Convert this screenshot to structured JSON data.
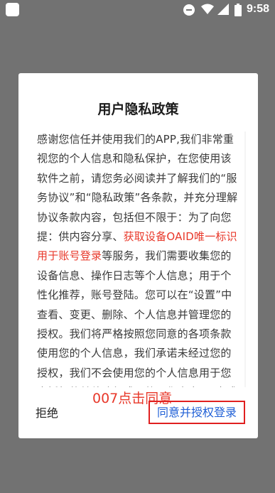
{
  "status_bar": {
    "time": "9:58",
    "icons": [
      "app-icon",
      "do-not-disturb-icon",
      "wifi-icon",
      "signal-icon",
      "battery-icon"
    ]
  },
  "dialog": {
    "title": "用户隐私政策",
    "body_before_link": "感谢您信任并使用我们的APP,我们非常重视您的个人信息和隐私保护，在您使用该软件之前，请您务必阅读并了解我们的“服务协议”和“隐私政策”各条款，并充分理解协议条款内容，包括但不限于：为了向您提：供内容分享、",
    "body_link": "获取设备OAID唯一标识用于账号登录",
    "body_after_link": "等服务，我们需要收集您的设备信息、操作日志等个人信息；用于个性化推荐，账号登陆。您可以在“设置”中查看、变更、删除、个人信息并管理您的授权。我们将严格按照您同意的各项条款使用您的个人信息，我们承诺未经过您的授权，我们不会使用您的个人信息用于您未授权的其他途径或目的。您点击“同意或拒绝”，",
    "annotation": "007点击同意",
    "reject_label": "拒绝",
    "agree_label": "同意并授权登录",
    "colors": {
      "link": "#e8382a",
      "agree": "#1f5fd6",
      "highlight_border": "#e02020",
      "overlay": "#727272"
    }
  }
}
